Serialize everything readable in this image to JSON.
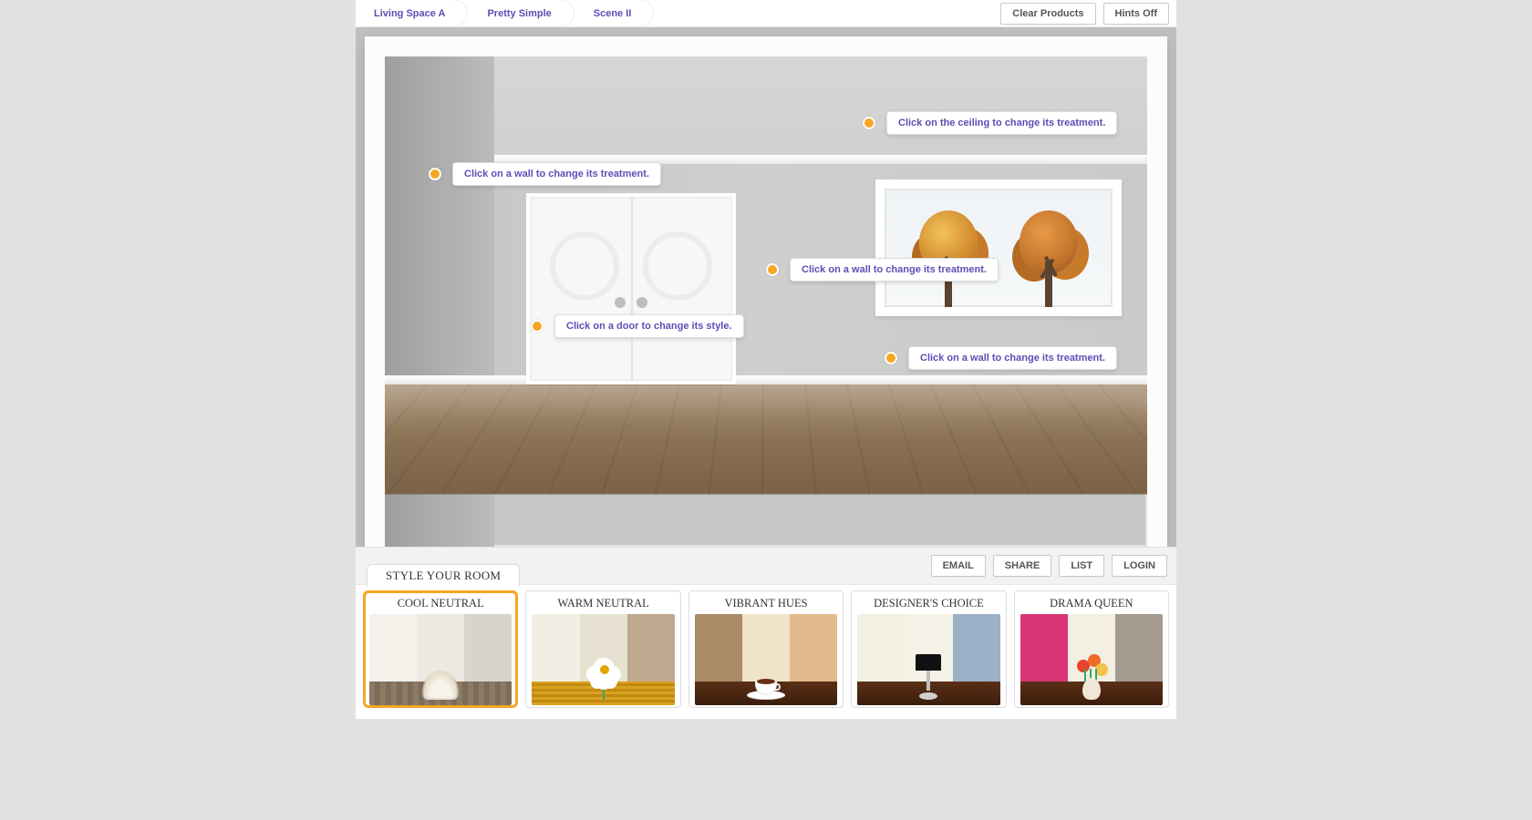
{
  "breadcrumbs": [
    "Living Space A",
    "Pretty Simple",
    "Scene II"
  ],
  "top_actions": {
    "clear": "Clear Products",
    "hints": "Hints Off"
  },
  "hints": {
    "ceiling": "Click on the ceiling to change its treatment.",
    "wall_left": "Click on a wall to change its treatment.",
    "door": "Click on a door to change its style.",
    "wall_mid": "Click on a wall to change its treatment.",
    "wall_right": "Click on a wall to change its treatment."
  },
  "lower_actions": {
    "email": "EMAIL",
    "share": "SHARE",
    "list": "LIST",
    "login": "LOGIN"
  },
  "style_tab": "STYLE YOUR ROOM",
  "palettes": [
    {
      "id": "cool-neutral",
      "title": "COOL NEUTRAL",
      "selected": true,
      "cols": [
        "#f3f1ea",
        "#ece9e0",
        "#d7d4cb"
      ],
      "ground": "repeating-linear-gradient(90deg,#8b7a65 0 6px,#7d6c57 6px 12px)",
      "object": "shell"
    },
    {
      "id": "warm-neutral",
      "title": "WARM NEUTRAL",
      "selected": false,
      "cols": [
        "#f2eee3",
        "#e7e1d2",
        "#bfa98e"
      ],
      "ground": "repeating-linear-gradient(0deg,#d8a21e 0 3px,#c28a12 3px 6px)",
      "object": "flower"
    },
    {
      "id": "vibrant-hues",
      "title": "VIBRANT HUES",
      "selected": false,
      "cols": [
        "#ab8a66",
        "#efe3c9",
        "#e2b98a"
      ],
      "ground": "linear-gradient(#5a2f16,#3c1e0d)",
      "object": "cup"
    },
    {
      "id": "designers-choice",
      "title": "DESIGNER'S CHOICE",
      "selected": false,
      "cols": [
        "#f2efe3",
        "#f4f1e6",
        "#9cb1c8"
      ],
      "ground": "linear-gradient(#5a2f16,#3c1e0d)",
      "object": "lamp"
    },
    {
      "id": "drama-queen",
      "title": "DRAMA QUEEN",
      "selected": false,
      "cols": [
        "#d93576",
        "#f3efe3",
        "#a59a8f"
      ],
      "ground": "linear-gradient(#5a2f16,#3c1e0d)",
      "object": "vase"
    }
  ]
}
